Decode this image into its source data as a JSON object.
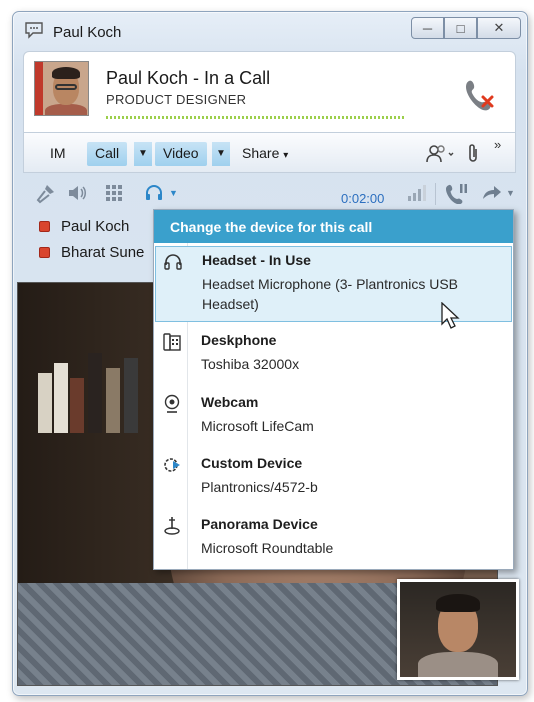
{
  "window": {
    "title": "Paul Koch",
    "controls": {
      "minimize": "─",
      "restore": "□",
      "close": "✕"
    }
  },
  "contact": {
    "name_status": "Paul Koch - In a Call",
    "job_title": "PRODUCT DESIGNER"
  },
  "tabs": {
    "im": "IM",
    "call": "Call",
    "video": "Video",
    "share": "Share",
    "share_caret": "▾",
    "more": "»"
  },
  "toolbar": {
    "timer": "0:02:00"
  },
  "participants": [
    {
      "name": "Paul Koch",
      "presence": "busy"
    },
    {
      "name": "Bharat Sune",
      "presence": "busy"
    }
  ],
  "device_menu": {
    "header": "Change the device for this call",
    "items": [
      {
        "name": "Headset - In Use",
        "detail": "Headset Microphone (3- Plantronics USB Headset)",
        "icon": "headset-icon",
        "selected": true
      },
      {
        "name": "Deskphone",
        "detail": "Toshiba 32000x",
        "icon": "deskphone-icon",
        "selected": false
      },
      {
        "name": "Webcam",
        "detail": "Microsoft LifeCam",
        "icon": "webcam-icon",
        "selected": false
      },
      {
        "name": "Custom Device",
        "detail": "Plantronics/4572-b",
        "icon": "custom-device-icon",
        "selected": false
      },
      {
        "name": "Panorama Device",
        "detail": "Microsoft Roundtable",
        "icon": "panorama-device-icon",
        "selected": false
      }
    ]
  },
  "colors": {
    "accent": "#3aa0cc",
    "presence_busy": "#d9452e",
    "timer": "#2c6fbf",
    "selected_bg": "#dff0f9"
  }
}
